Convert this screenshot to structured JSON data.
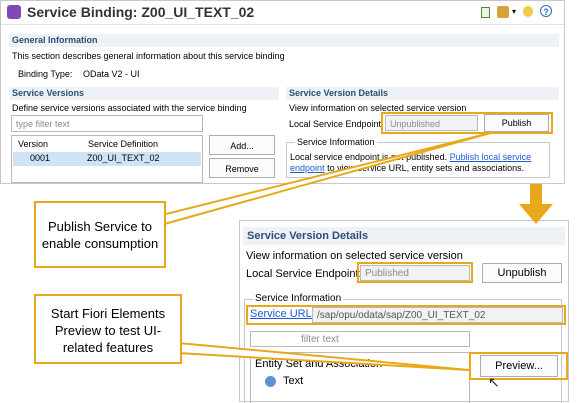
{
  "editor": {
    "title": "Service Binding: Z00_UI_TEXT_02",
    "toolbar_icons": [
      "document-icon",
      "settings-icon",
      "dropdown-icon",
      "lightbulb-icon",
      "help-icon"
    ]
  },
  "general_information": {
    "heading": "General Information",
    "description": "This section describes general information about this service binding",
    "binding_type_label": "Binding Type:",
    "binding_type_value": "OData V2 - UI"
  },
  "service_versions": {
    "heading": "Service Versions",
    "description": "Define service versions associated with the service binding",
    "filter_placeholder": "type filter text",
    "columns": [
      "Version",
      "Service Definition"
    ],
    "rows": [
      {
        "version": "0001",
        "definition": "Z00_UI_TEXT_02"
      }
    ],
    "add_button": "Add...",
    "remove_button": "Remove"
  },
  "version_details_top": {
    "heading": "Service Version Details",
    "description": "View information on selected service version",
    "endpoint_label": "Local Service Endpoint:",
    "endpoint_value": "Unpublished",
    "publish_button": "Publish",
    "info_heading": "Service Information",
    "info_text_1": "Local service endpoint is not published.",
    "info_link": "Publish local service endpoint",
    "info_text_2": "to view service URL, entity sets and associations."
  },
  "version_details_bottom": {
    "heading": "Service Version Details",
    "description": "View information on selected service version",
    "endpoint_label": "Local Service Endpoint:",
    "endpoint_value": "Published",
    "unpublish_button": "Unpublish",
    "info_heading": "Service Information",
    "service_url_label": "Service URL:",
    "service_url_value": "/sap/opu/odata/sap/Z00_UI_TEXT_02",
    "filter_placeholder": "filter text",
    "table_header": "Entity Set and Association",
    "entity_item": "Text",
    "preview_button": "Preview..."
  },
  "callouts": {
    "publish": "Publish Service to enable consumption",
    "preview": "Start Fiori Elements Preview to test UI-related features"
  },
  "colors": {
    "accent": "#e8a81a",
    "selection": "#cfe3f7",
    "link": "#1a5bd6",
    "header_text": "#2b4f76"
  }
}
